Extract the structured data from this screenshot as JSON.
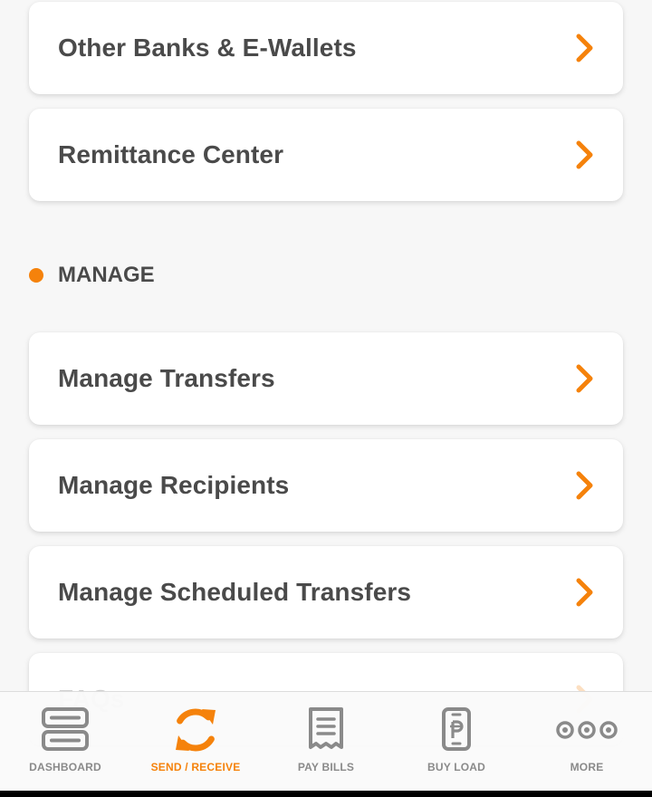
{
  "cards_top": [
    {
      "label": "Other Banks & E-Wallets"
    },
    {
      "label": "Remittance Center"
    }
  ],
  "manage_section": {
    "title": "MANAGE",
    "items": [
      {
        "label": "Manage Transfers"
      },
      {
        "label": "Manage Recipients"
      },
      {
        "label": "Manage Scheduled Transfers"
      },
      {
        "label": "FAQs"
      }
    ]
  },
  "bottom_nav": {
    "items": [
      {
        "label": "DASHBOARD",
        "icon": "dashboard-icon",
        "active": false
      },
      {
        "label": "SEND / RECEIVE",
        "icon": "refresh-icon",
        "active": true
      },
      {
        "label": "PAY BILLS",
        "icon": "receipt-icon",
        "active": false
      },
      {
        "label": "BUY LOAD",
        "icon": "phone-load-icon",
        "active": false
      },
      {
        "label": "MORE",
        "icon": "more-icon",
        "active": false
      }
    ]
  },
  "colors": {
    "accent": "#f5820b",
    "text": "#4a4a4a",
    "nav_inactive": "#8a8a8a",
    "background": "#f7f7f7"
  }
}
